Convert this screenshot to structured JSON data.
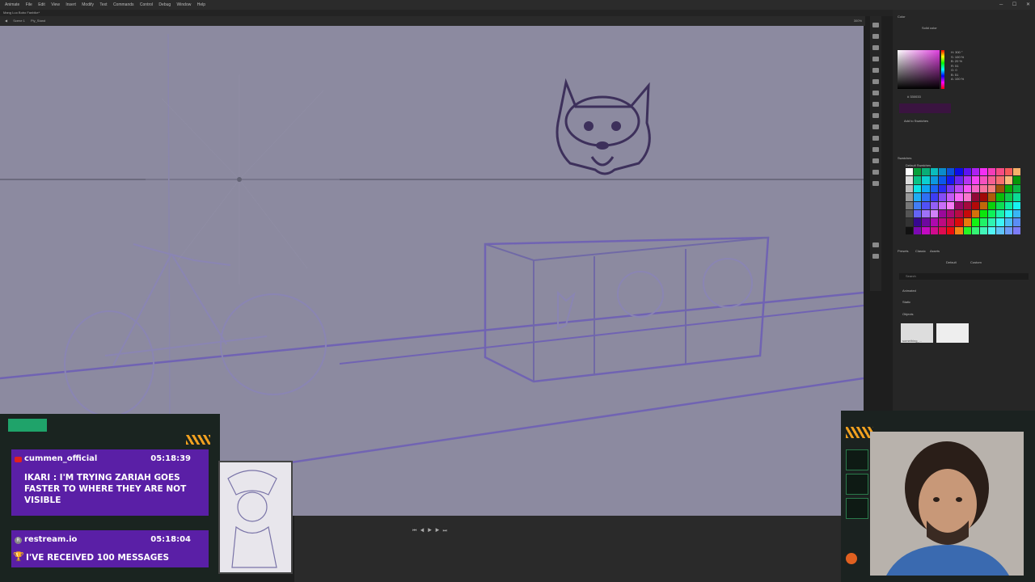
{
  "app": {
    "menu": [
      "Animate",
      "File",
      "Edit",
      "View",
      "Insert",
      "Modify",
      "Text",
      "Commands",
      "Control",
      "Debug",
      "Window",
      "Help"
    ],
    "document_title": "Mang Luo Bobo Fanbike*",
    "scene": [
      "Scene 1",
      "Ply_Stand"
    ],
    "zoom": "300%"
  },
  "color_panel": {
    "title": "Color",
    "fill_type": "Solid color",
    "values": [
      "H: 300 °",
      "S: 100 %",
      "B: 20 %",
      "R: 51",
      "G: 0",
      "B: 51",
      "A: 100 %"
    ],
    "hex": "# 330033",
    "current_color": "#3a1440",
    "add_swatch": "Add to Swatches"
  },
  "swatches_panel": {
    "title": "Swatches",
    "palette": "Default Swatches"
  },
  "library_panel": {
    "tabs": [
      "Presets",
      "Classic",
      "Assets"
    ],
    "buttons": [
      "Default",
      "Custom"
    ],
    "search_placeholder": "Search",
    "sections": [
      "Animated",
      "Static",
      "Objects"
    ],
    "thumb_label": "something_..."
  },
  "chat": {
    "messages": [
      {
        "platform": "youtube-icon",
        "user": "cummen_official",
        "time": "05:18:39",
        "text": "IKARI : I'm trying Zariah goes faster to where they are not visible"
      },
      {
        "platform": "restream-icon",
        "user": "restream.io",
        "time": "05:18:04",
        "text": "I've received 100 messages"
      }
    ]
  },
  "colors": {
    "accent": "#5a1fa6",
    "stage": "#8c8aa0",
    "sketch": "#5c4ea8",
    "frame_green": "#1fa36a"
  }
}
